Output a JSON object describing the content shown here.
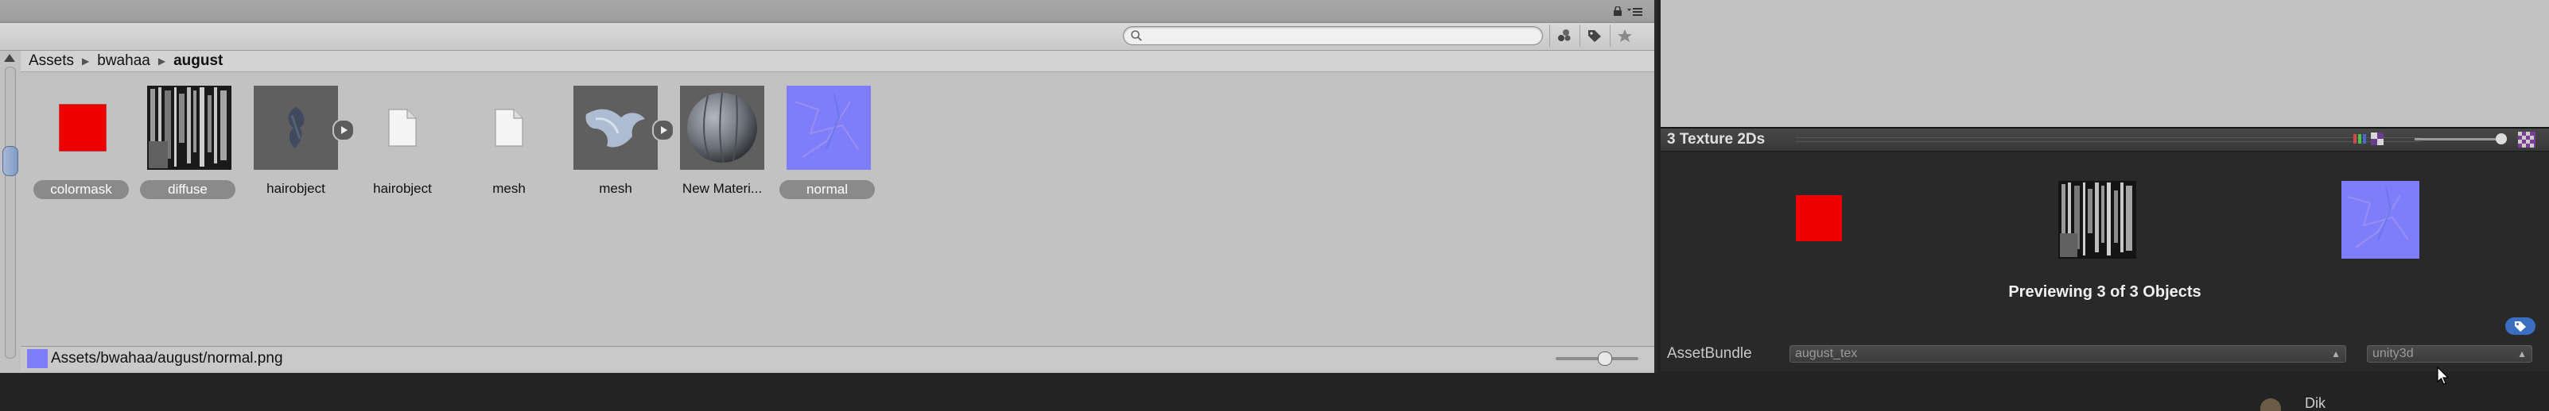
{
  "project": {
    "search": {
      "value": "",
      "placeholder": ""
    },
    "toolbar_icons": [
      "filter-by-type-icon",
      "filter-by-label-icon",
      "favorites-star-icon"
    ],
    "breadcrumb": [
      "Assets",
      "bwahaa",
      "august"
    ],
    "assets": [
      {
        "label": "colormask",
        "kind": "texture-red",
        "selected": true,
        "expandable": false
      },
      {
        "label": "diffuse",
        "kind": "texture-diffuse",
        "selected": true,
        "expandable": false
      },
      {
        "label": "hairobject",
        "kind": "prefab-hair",
        "selected": false,
        "expandable": true
      },
      {
        "label": "hairobject",
        "kind": "file",
        "selected": false,
        "expandable": false
      },
      {
        "label": "mesh",
        "kind": "file",
        "selected": false,
        "expandable": false
      },
      {
        "label": "mesh",
        "kind": "prefab-mesh",
        "selected": false,
        "expandable": true
      },
      {
        "label": "New Materi...",
        "kind": "material-sphere",
        "selected": false,
        "expandable": false
      },
      {
        "label": "normal",
        "kind": "texture-normal",
        "selected": true,
        "expandable": false
      }
    ],
    "status_path": "Assets/bwahaa/august/normal.png",
    "zoom_level": 0.6
  },
  "preview": {
    "title": "3 Texture 2Ds",
    "caption": "Previewing 3 of 3 Objects",
    "size_level": 1.0,
    "textures": [
      "colormask",
      "diffuse",
      "normal"
    ]
  },
  "assetbundle": {
    "label": "AssetBundle",
    "name": "august_tex",
    "variant": "unity3d"
  },
  "bottom": {
    "text": "Dik"
  },
  "colors": {
    "panel_bg": "#c2c2c2",
    "inspector_bg": "#292929",
    "selection": "#8a8a8a",
    "colormask": "#ee0000",
    "normal_map": "#7e7efa"
  }
}
